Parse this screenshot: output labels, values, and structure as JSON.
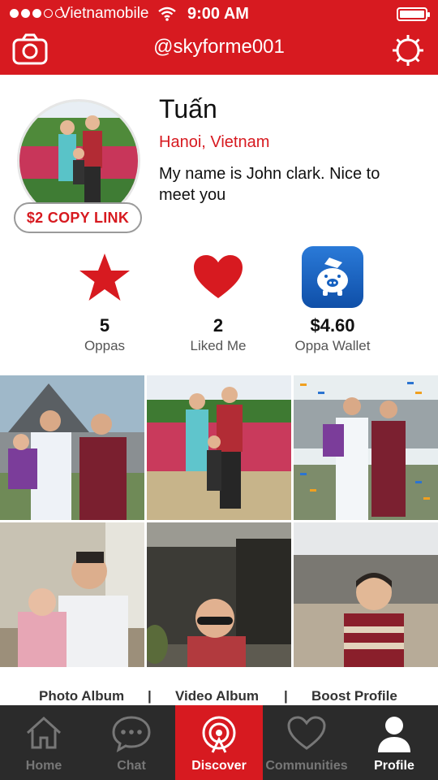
{
  "status_bar": {
    "carrier": "Vietnamobile",
    "time": "9:00 AM"
  },
  "nav": {
    "title": "@skyforme001",
    "left_icon": "camera-icon",
    "right_icon": "settings-icon"
  },
  "profile": {
    "name": "Tuấn",
    "location": "Hanoi, Vietnam",
    "bio": "My name is John clark. Nice to meet you",
    "copy_link_label": "$2 COPY LINK"
  },
  "stats": [
    {
      "icon": "star-icon",
      "value": "5",
      "label": "Oppas"
    },
    {
      "icon": "heart-icon",
      "value": "2",
      "label": "Liked Me"
    },
    {
      "icon": "piggy-bank-icon",
      "value": "$4.60",
      "label": "Oppa Wallet"
    }
  ],
  "links": {
    "photo_album": "Photo Album",
    "separator": "|",
    "video_album": "Video Album",
    "boost_profile": "Boost Profile"
  },
  "tabs": [
    {
      "label": "Home",
      "icon": "home-icon"
    },
    {
      "label": "Chat",
      "icon": "chat-icon"
    },
    {
      "label": "Discover",
      "icon": "discover-icon",
      "active": true
    },
    {
      "label": "Communities",
      "icon": "heart-outline-icon"
    },
    {
      "label": "Profile",
      "icon": "person-icon"
    }
  ],
  "colors": {
    "brand_red": "#d71a20",
    "tabbar_bg": "#2b2b2b",
    "wallet_blue": "#1560c0"
  }
}
